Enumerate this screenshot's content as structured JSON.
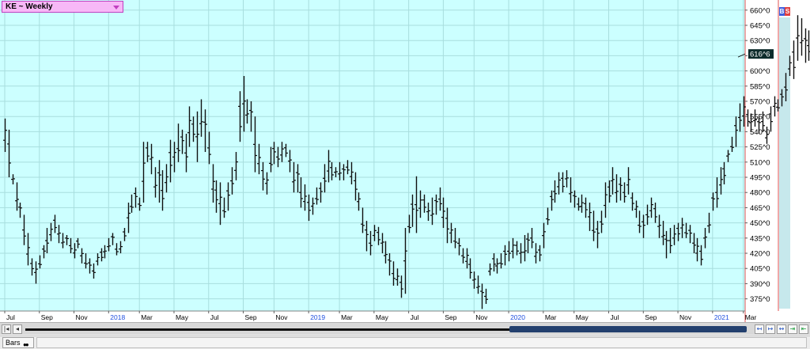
{
  "window": {
    "symbol_label": "KE ~ Weekly",
    "bs_buy": "B",
    "bs_sell": "S",
    "status_tab": "Bars",
    "status_icon": "glasses-icon"
  },
  "colors": {
    "plot_bg": "#ccffff",
    "grid": "#a8dede",
    "bar": "#101010",
    "axis_line": "#e05050",
    "price_label_bg": "#0d2b2b",
    "price_label_fg": "#ffffff",
    "year_label": "#2050e0"
  },
  "chart_data": {
    "type": "bar",
    "subtype": "ohlc",
    "title": "KE ~ Weekly",
    "grid": true,
    "last_price_label": "616^6",
    "y_ticks": [
      "660^0",
      "645^0",
      "630^0",
      "615^0",
      "600^0",
      "585^0",
      "570^0",
      "555^0",
      "540^0",
      "525^0",
      "510^0",
      "495^0",
      "480^0",
      "465^0",
      "450^0",
      "435^0",
      "420^0",
      "405^0",
      "390^0",
      "375^0"
    ],
    "y_tick_values": [
      660,
      645,
      630,
      615,
      600,
      585,
      570,
      555,
      540,
      525,
      510,
      495,
      480,
      465,
      450,
      435,
      420,
      405,
      390,
      375
    ],
    "ylim": [
      363,
      670
    ],
    "x_range": [
      0,
      190
    ],
    "x_ticks": [
      {
        "label": "Jul",
        "x": 0,
        "year": false
      },
      {
        "label": "Sep",
        "x": 9,
        "year": false
      },
      {
        "label": "Nov",
        "x": 18,
        "year": false
      },
      {
        "label": "2018",
        "x": 27,
        "year": true
      },
      {
        "label": "Mar",
        "x": 35,
        "year": false
      },
      {
        "label": "May",
        "x": 44,
        "year": false
      },
      {
        "label": "Jul",
        "x": 53,
        "year": false
      },
      {
        "label": "Sep",
        "x": 62,
        "year": false
      },
      {
        "label": "Nov",
        "x": 70,
        "year": false
      },
      {
        "label": "2019",
        "x": 79,
        "year": true
      },
      {
        "label": "Mar",
        "x": 87,
        "year": false
      },
      {
        "label": "May",
        "x": 96,
        "year": false
      },
      {
        "label": "Jul",
        "x": 105,
        "year": false
      },
      {
        "label": "Sep",
        "x": 114,
        "year": false
      },
      {
        "label": "Nov",
        "x": 122,
        "year": false
      },
      {
        "label": "2020",
        "x": 131,
        "year": true
      },
      {
        "label": "Mar",
        "x": 140,
        "year": false
      },
      {
        "label": "May",
        "x": 148,
        "year": false
      },
      {
        "label": "Jul",
        "x": 157,
        "year": false
      },
      {
        "label": "Sep",
        "x": 166,
        "year": false
      },
      {
        "label": "Nov",
        "x": 175,
        "year": false
      },
      {
        "label": "2021",
        "x": 184,
        "year": true
      },
      {
        "label": "Mar",
        "x": 192,
        "year": false
      }
    ],
    "weekly_hl": [
      [
        553,
        520
      ],
      [
        542,
        495
      ],
      [
        498,
        488
      ],
      [
        490,
        462
      ],
      [
        470,
        455
      ],
      [
        458,
        428
      ],
      [
        440,
        408
      ],
      [
        415,
        398
      ],
      [
        412,
        390
      ],
      [
        418,
        405
      ],
      [
        428,
        415
      ],
      [
        445,
        420
      ],
      [
        450,
        432
      ],
      [
        458,
        440
      ],
      [
        448,
        430
      ],
      [
        440,
        425
      ],
      [
        438,
        428
      ],
      [
        435,
        420
      ],
      [
        430,
        415
      ],
      [
        435,
        425
      ],
      [
        425,
        410
      ],
      [
        420,
        405
      ],
      [
        415,
        400
      ],
      [
        410,
        395
      ],
      [
        420,
        408
      ],
      [
        425,
        412
      ],
      [
        428,
        415
      ],
      [
        435,
        422
      ],
      [
        440,
        428
      ],
      [
        430,
        418
      ],
      [
        432,
        420
      ],
      [
        445,
        432
      ],
      [
        470,
        440
      ],
      [
        478,
        460
      ],
      [
        485,
        465
      ],
      [
        475,
        462
      ],
      [
        530,
        470
      ],
      [
        530,
        510
      ],
      [
        528,
        498
      ],
      [
        505,
        475
      ],
      [
        512,
        470
      ],
      [
        502,
        462
      ],
      [
        508,
        480
      ],
      [
        532,
        490
      ],
      [
        530,
        500
      ],
      [
        548,
        510
      ],
      [
        542,
        518
      ],
      [
        538,
        500
      ],
      [
        565,
        525
      ],
      [
        555,
        530
      ],
      [
        560,
        510
      ],
      [
        572,
        535
      ],
      [
        562,
        520
      ],
      [
        540,
        508
      ],
      [
        508,
        470
      ],
      [
        492,
        460
      ],
      [
        490,
        448
      ],
      [
        475,
        455
      ],
      [
        490,
        462
      ],
      [
        505,
        478
      ],
      [
        520,
        492
      ],
      [
        580,
        530
      ],
      [
        595,
        540
      ],
      [
        572,
        548
      ],
      [
        570,
        540
      ],
      [
        555,
        500
      ],
      [
        528,
        498
      ],
      [
        510,
        482
      ],
      [
        500,
        478
      ],
      [
        525,
        500
      ],
      [
        530,
        508
      ],
      [
        525,
        505
      ],
      [
        530,
        510
      ],
      [
        528,
        515
      ],
      [
        522,
        500
      ],
      [
        510,
        480
      ],
      [
        508,
        480
      ],
      [
        495,
        465
      ],
      [
        488,
        462
      ],
      [
        478,
        452
      ],
      [
        475,
        458
      ],
      [
        485,
        468
      ],
      [
        490,
        470
      ],
      [
        508,
        480
      ],
      [
        522,
        490
      ],
      [
        510,
        492
      ],
      [
        505,
        495
      ],
      [
        510,
        492
      ],
      [
        508,
        492
      ],
      [
        512,
        498
      ],
      [
        510,
        488
      ],
      [
        500,
        472
      ],
      [
        480,
        462
      ],
      [
        465,
        440
      ],
      [
        452,
        422
      ],
      [
        442,
        418
      ],
      [
        448,
        432
      ],
      [
        446,
        428
      ],
      [
        440,
        420
      ],
      [
        432,
        410
      ],
      [
        420,
        398
      ],
      [
        412,
        388
      ],
      [
        405,
        388
      ],
      [
        398,
        376
      ],
      [
        445,
        380
      ],
      [
        458,
        440
      ],
      [
        478,
        446
      ],
      [
        496,
        440
      ],
      [
        482,
        455
      ],
      [
        478,
        460
      ],
      [
        470,
        452
      ],
      [
        475,
        448
      ],
      [
        478,
        458
      ],
      [
        485,
        462
      ],
      [
        475,
        445
      ],
      [
        465,
        430
      ],
      [
        450,
        430
      ],
      [
        445,
        425
      ],
      [
        435,
        418
      ],
      [
        425,
        410
      ],
      [
        425,
        405
      ],
      [
        415,
        395
      ],
      [
        402,
        385
      ],
      [
        398,
        380
      ],
      [
        390,
        365
      ],
      [
        385,
        370
      ],
      [
        410,
        398
      ],
      [
        420,
        402
      ],
      [
        415,
        400
      ],
      [
        420,
        405
      ],
      [
        428,
        408
      ],
      [
        432,
        412
      ],
      [
        435,
        415
      ],
      [
        432,
        418
      ],
      [
        430,
        410
      ],
      [
        438,
        412
      ],
      [
        440,
        420
      ],
      [
        445,
        425
      ],
      [
        430,
        410
      ],
      [
        428,
        412
      ],
      [
        450,
        425
      ],
      [
        465,
        448
      ],
      [
        482,
        462
      ],
      [
        492,
        470
      ],
      [
        500,
        478
      ],
      [
        500,
        480
      ],
      [
        502,
        485
      ],
      [
        495,
        470
      ],
      [
        482,
        465
      ],
      [
        475,
        462
      ],
      [
        478,
        460
      ],
      [
        475,
        455
      ],
      [
        470,
        442
      ],
      [
        462,
        432
      ],
      [
        452,
        425
      ],
      [
        462,
        440
      ],
      [
        490,
        455
      ],
      [
        492,
        470
      ],
      [
        505,
        478
      ],
      [
        498,
        470
      ],
      [
        495,
        472
      ],
      [
        490,
        470
      ],
      [
        505,
        478
      ],
      [
        480,
        462
      ],
      [
        472,
        455
      ],
      [
        462,
        440
      ],
      [
        458,
        435
      ],
      [
        468,
        448
      ],
      [
        475,
        455
      ],
      [
        470,
        450
      ],
      [
        458,
        435
      ],
      [
        452,
        428
      ],
      [
        442,
        415
      ],
      [
        445,
        420
      ],
      [
        448,
        428
      ],
      [
        450,
        432
      ],
      [
        455,
        435
      ],
      [
        450,
        435
      ],
      [
        448,
        430
      ],
      [
        440,
        420
      ],
      [
        435,
        412
      ],
      [
        428,
        408
      ],
      [
        445,
        425
      ],
      [
        460,
        440
      ],
      [
        480,
        462
      ],
      [
        495,
        465
      ],
      [
        505,
        478
      ],
      [
        510,
        488
      ],
      [
        522,
        510
      ],
      [
        535,
        520
      ],
      [
        555,
        525
      ],
      [
        568,
        540
      ],
      [
        575,
        545
      ],
      [
        562,
        545
      ],
      [
        558,
        540
      ],
      [
        562,
        545
      ],
      [
        555,
        538
      ],
      [
        560,
        540
      ],
      [
        545,
        528
      ],
      [
        565,
        540
      ],
      [
        575,
        555
      ],
      [
        572,
        560
      ],
      [
        582,
        565
      ],
      [
        598,
        570
      ],
      [
        615,
        595
      ],
      [
        630,
        592
      ],
      [
        655,
        610
      ],
      [
        652,
        615
      ],
      [
        642,
        608
      ],
      [
        640,
        610
      ],
      [
        636,
        612
      ]
    ]
  }
}
